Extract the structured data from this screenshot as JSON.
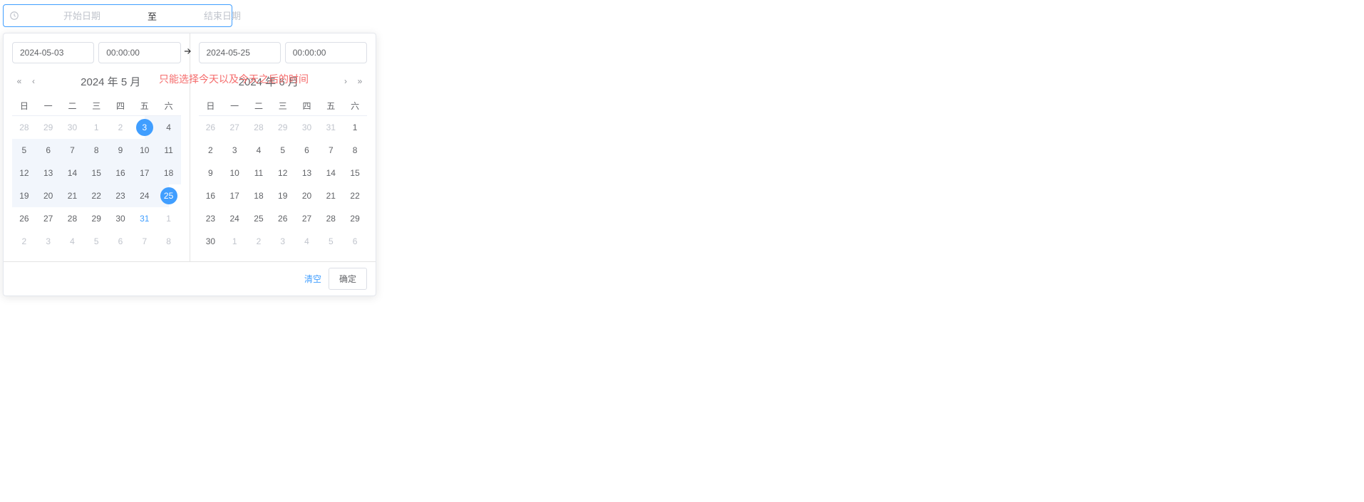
{
  "rangeInput": {
    "startPlaceholder": "开始日期",
    "separator": "至",
    "endPlaceholder": "结束日期"
  },
  "overlay": "只能选择今天以及今天之后的时间",
  "left": {
    "dateValue": "2024-05-03",
    "timeValue": "00:00:00",
    "header": "2024 年 5 月",
    "weekdays": [
      "日",
      "一",
      "二",
      "三",
      "四",
      "五",
      "六"
    ],
    "weeks": [
      [
        {
          "d": "28",
          "t": "other"
        },
        {
          "d": "29",
          "t": "other"
        },
        {
          "d": "30",
          "t": "other"
        },
        {
          "d": "1",
          "t": "other"
        },
        {
          "d": "2",
          "t": "other"
        },
        {
          "d": "3",
          "t": "start"
        },
        {
          "d": "4",
          "t": "in-range"
        }
      ],
      [
        {
          "d": "5",
          "t": "in-range"
        },
        {
          "d": "6",
          "t": "in-range"
        },
        {
          "d": "7",
          "t": "in-range"
        },
        {
          "d": "8",
          "t": "in-range"
        },
        {
          "d": "9",
          "t": "in-range"
        },
        {
          "d": "10",
          "t": "in-range"
        },
        {
          "d": "11",
          "t": "in-range"
        }
      ],
      [
        {
          "d": "12",
          "t": "in-range"
        },
        {
          "d": "13",
          "t": "in-range"
        },
        {
          "d": "14",
          "t": "in-range"
        },
        {
          "d": "15",
          "t": "in-range"
        },
        {
          "d": "16",
          "t": "in-range"
        },
        {
          "d": "17",
          "t": "in-range"
        },
        {
          "d": "18",
          "t": "in-range"
        }
      ],
      [
        {
          "d": "19",
          "t": "in-range"
        },
        {
          "d": "20",
          "t": "in-range"
        },
        {
          "d": "21",
          "t": "in-range"
        },
        {
          "d": "22",
          "t": "in-range"
        },
        {
          "d": "23",
          "t": "in-range"
        },
        {
          "d": "24",
          "t": "in-range"
        },
        {
          "d": "25",
          "t": "end"
        }
      ],
      [
        {
          "d": "26",
          "t": ""
        },
        {
          "d": "27",
          "t": ""
        },
        {
          "d": "28",
          "t": ""
        },
        {
          "d": "29",
          "t": ""
        },
        {
          "d": "30",
          "t": ""
        },
        {
          "d": "31",
          "t": "today-blue"
        },
        {
          "d": "1",
          "t": "other"
        }
      ],
      [
        {
          "d": "2",
          "t": "other"
        },
        {
          "d": "3",
          "t": "other"
        },
        {
          "d": "4",
          "t": "other"
        },
        {
          "d": "5",
          "t": "other"
        },
        {
          "d": "6",
          "t": "other"
        },
        {
          "d": "7",
          "t": "other"
        },
        {
          "d": "8",
          "t": "other"
        }
      ]
    ]
  },
  "right": {
    "dateValue": "2024-05-25",
    "timeValue": "00:00:00",
    "header": "2024 年 6 月",
    "weekdays": [
      "日",
      "一",
      "二",
      "三",
      "四",
      "五",
      "六"
    ],
    "weeks": [
      [
        {
          "d": "26",
          "t": "other"
        },
        {
          "d": "27",
          "t": "other"
        },
        {
          "d": "28",
          "t": "other"
        },
        {
          "d": "29",
          "t": "other"
        },
        {
          "d": "30",
          "t": "other"
        },
        {
          "d": "31",
          "t": "other"
        },
        {
          "d": "1",
          "t": ""
        }
      ],
      [
        {
          "d": "2",
          "t": ""
        },
        {
          "d": "3",
          "t": ""
        },
        {
          "d": "4",
          "t": ""
        },
        {
          "d": "5",
          "t": ""
        },
        {
          "d": "6",
          "t": ""
        },
        {
          "d": "7",
          "t": ""
        },
        {
          "d": "8",
          "t": ""
        }
      ],
      [
        {
          "d": "9",
          "t": ""
        },
        {
          "d": "10",
          "t": ""
        },
        {
          "d": "11",
          "t": ""
        },
        {
          "d": "12",
          "t": ""
        },
        {
          "d": "13",
          "t": ""
        },
        {
          "d": "14",
          "t": ""
        },
        {
          "d": "15",
          "t": ""
        }
      ],
      [
        {
          "d": "16",
          "t": ""
        },
        {
          "d": "17",
          "t": ""
        },
        {
          "d": "18",
          "t": ""
        },
        {
          "d": "19",
          "t": ""
        },
        {
          "d": "20",
          "t": ""
        },
        {
          "d": "21",
          "t": ""
        },
        {
          "d": "22",
          "t": ""
        }
      ],
      [
        {
          "d": "23",
          "t": ""
        },
        {
          "d": "24",
          "t": ""
        },
        {
          "d": "25",
          "t": ""
        },
        {
          "d": "26",
          "t": ""
        },
        {
          "d": "27",
          "t": ""
        },
        {
          "d": "28",
          "t": ""
        },
        {
          "d": "29",
          "t": ""
        }
      ],
      [
        {
          "d": "30",
          "t": ""
        },
        {
          "d": "1",
          "t": "other"
        },
        {
          "d": "2",
          "t": "other"
        },
        {
          "d": "3",
          "t": "other"
        },
        {
          "d": "4",
          "t": "other"
        },
        {
          "d": "5",
          "t": "other"
        },
        {
          "d": "6",
          "t": "other"
        }
      ]
    ]
  },
  "footer": {
    "clear": "清空",
    "confirm": "确定"
  },
  "nav": {
    "prevYear": "«",
    "prevMonth": "‹",
    "nextMonth": "›",
    "nextYear": "»"
  }
}
